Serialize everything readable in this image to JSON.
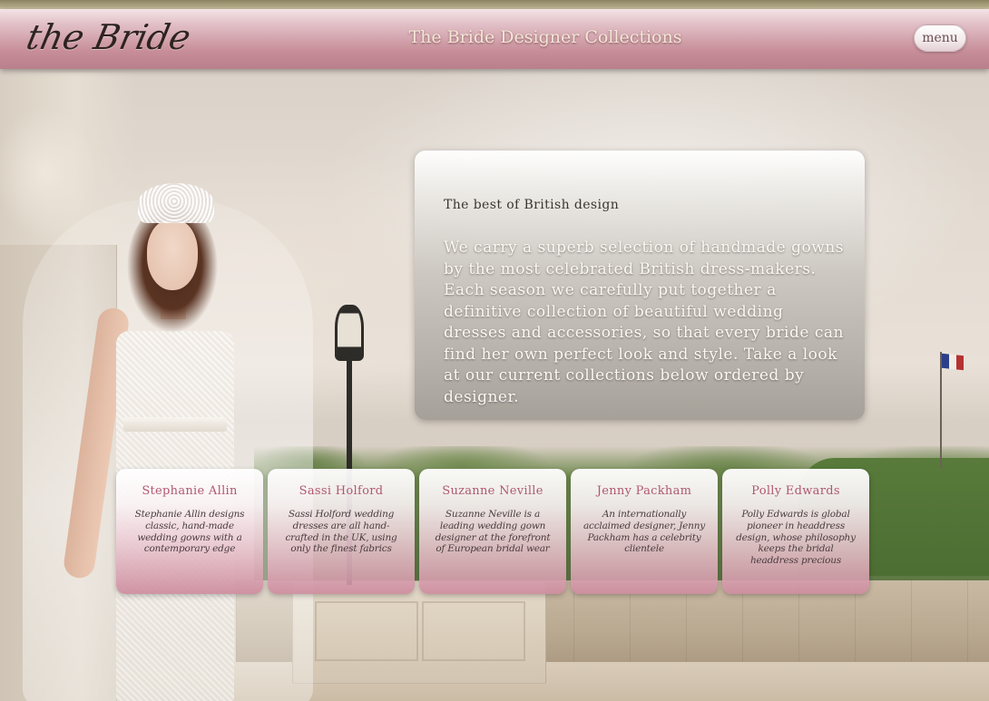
{
  "header": {
    "logo_text": "the Bride",
    "site_title": "The Bride Designer Collections",
    "menu_label": "menu"
  },
  "info": {
    "heading": "The best of British design",
    "paragraph_1": "We carry a superb selection of handmade gowns by the most celebrated British dress-makers.",
    "paragraph_2": "Each season we carefully put together a definitive collection of beautiful wedding dresses and accessories, so that every bride can find her own perfect look and style. Take a look at our current collections below ordered by designer."
  },
  "designers": [
    {
      "name": "Stephanie Allin",
      "description": "Stephanie Allin designs classic, hand-made wedding gowns with a contemporary edge"
    },
    {
      "name": "Sassi Holford",
      "description": "Sassi Holford wedding dresses are all hand-crafted in the UK, using only the finest fabrics"
    },
    {
      "name": "Suzanne Neville",
      "description": "Suzanne Neville is a leading wedding gown designer at the forefront of European bridal wear"
    },
    {
      "name": "Jenny Packham",
      "description": "An internationally acclaimed designer, Jenny Packham has a celebrity clientele"
    },
    {
      "name": "Polly Edwards",
      "description": "Polly Edwards is global pioneer in headdress design, whose philosophy keeps the bridal headdress precious"
    }
  ],
  "colors": {
    "header_pink": "#c78e99",
    "designer_name": "#b05870",
    "title_cream": "#f4e7d6"
  }
}
